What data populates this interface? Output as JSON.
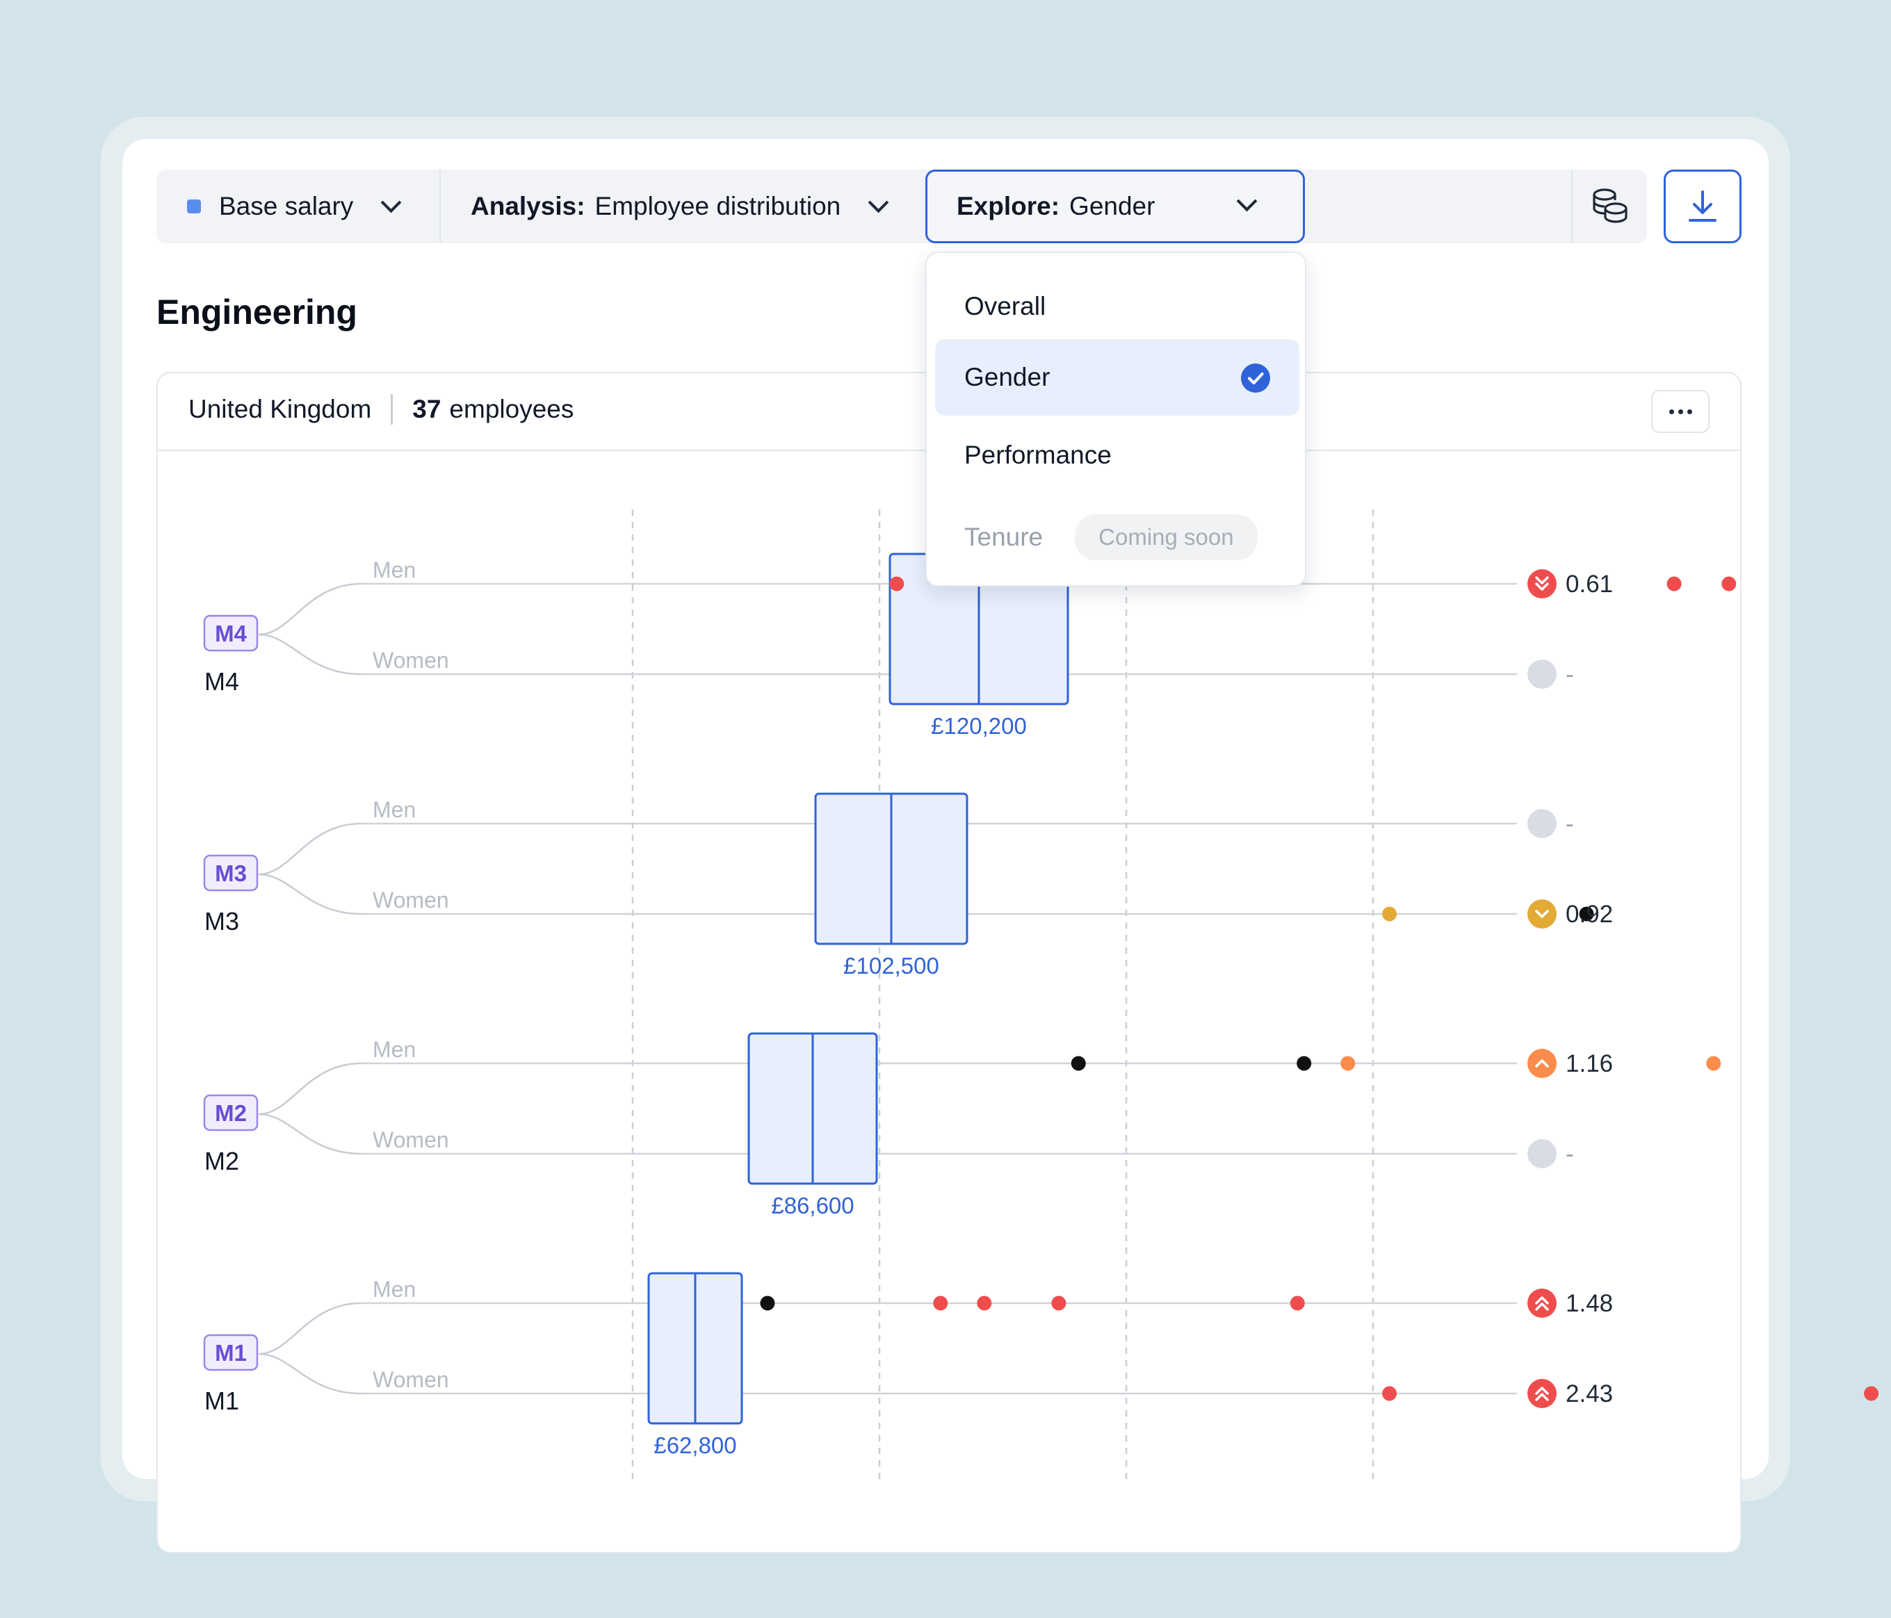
{
  "toolbar": {
    "metric_label": "Base salary",
    "analysis_prefix": "Analysis:",
    "analysis_value": "Employee distribution",
    "explore_prefix": "Explore:",
    "explore_value": "Gender",
    "metric_color": "#5b8def"
  },
  "page_title": "Engineering",
  "panel": {
    "location": "United Kingdom",
    "employee_count": "37",
    "employee_suffix": "employees"
  },
  "explore_menu": {
    "options": [
      {
        "label": "Overall",
        "selected": false,
        "disabled": false
      },
      {
        "label": "Gender",
        "selected": true,
        "disabled": false
      },
      {
        "label": "Performance",
        "selected": false,
        "disabled": false
      },
      {
        "label": "Tenure",
        "selected": false,
        "disabled": true,
        "badge": "Coming soon"
      }
    ]
  },
  "colors": {
    "accent": "#2f63d9",
    "box_fill": "#e8effc",
    "red": "#ef4d4d",
    "orange": "#fb8c4b",
    "amber": "#e3aa35",
    "neutral": "#d9dde3",
    "level_purple": "#6a4bd6"
  },
  "chart_data": {
    "type": "box_strip",
    "x_axis_unit": "GBP",
    "levels": [
      {
        "code": "M4",
        "name": "M4",
        "box_median_label": "£120,200",
        "groups": [
          {
            "label": "Men",
            "ratio": "0.61",
            "status": "well-below",
            "points": [
              72000,
              107500,
              110000
            ]
          },
          {
            "label": "Women",
            "ratio": "-",
            "status": "none",
            "points": []
          }
        ]
      },
      {
        "code": "M3",
        "name": "M3",
        "box_median_label": "£102,500",
        "groups": [
          {
            "label": "Men",
            "ratio": "-",
            "status": "none",
            "points": []
          },
          {
            "label": "Women",
            "ratio": "0.92",
            "status": "below",
            "points": [
              "outlier:94500",
              "in-range:103500"
            ]
          }
        ]
      },
      {
        "code": "M2",
        "name": "M2",
        "box_median_label": "£86,600",
        "groups": [
          {
            "label": "Men",
            "ratio": "1.16",
            "status": "above",
            "points": [
              "in-range:80300",
              "in-range:90600",
              "outlier:92600",
              "outlier:109300"
            ]
          },
          {
            "label": "Women",
            "ratio": "-",
            "status": "none",
            "points": []
          }
        ]
      },
      {
        "code": "M1",
        "name": "M1",
        "box_median_label": "£62,800",
        "groups": [
          {
            "label": "Men",
            "ratio": "1.48",
            "status": "well-above",
            "points": [
              "in-range:66100",
              "outlier:74000",
              "outlier:76000",
              "outlier:79400",
              "outlier:90300"
            ]
          },
          {
            "label": "Women",
            "ratio": "2.43",
            "status": "well-above",
            "points": [
              "outlier:94500",
              "outlier:116500"
            ]
          }
        ]
      }
    ]
  }
}
